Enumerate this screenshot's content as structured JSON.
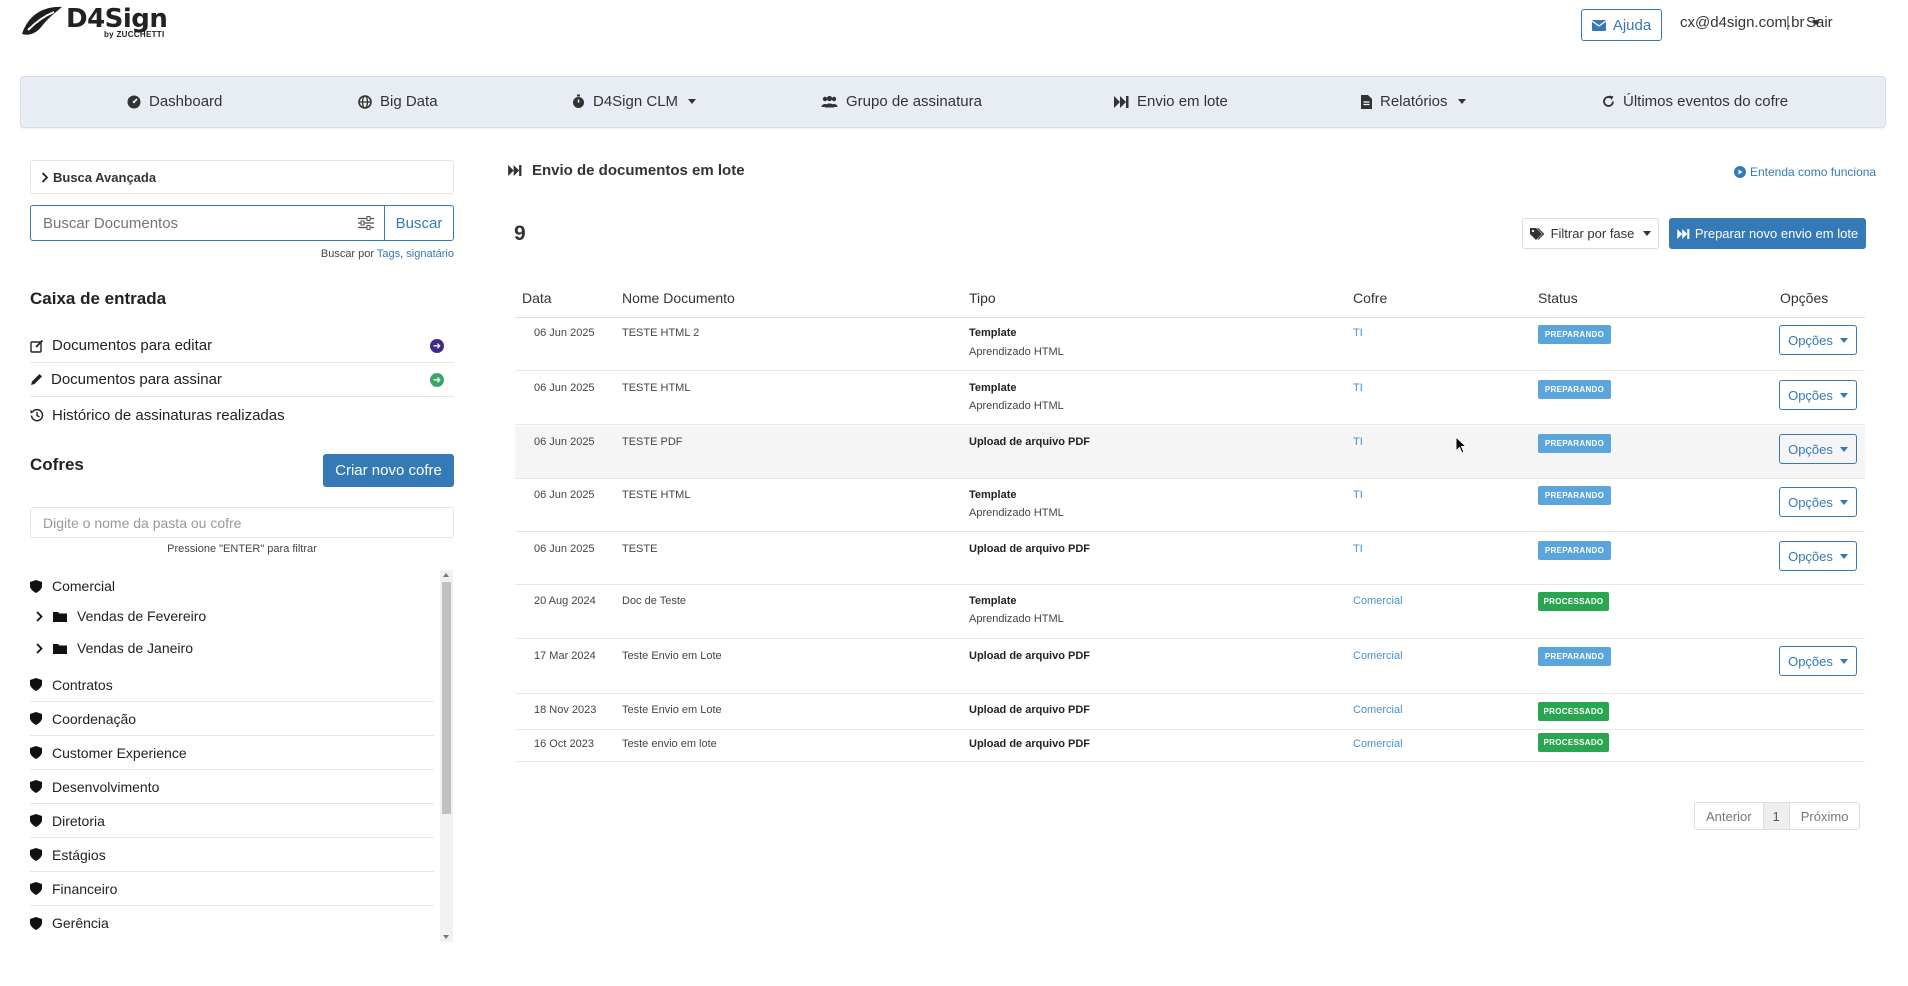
{
  "header": {
    "logo_text": "D4Sign",
    "logo_sub": "by ZUCCHETTI",
    "help_label": "Ajuda",
    "user_email": "cx@d4sign.com.br",
    "separator": "|",
    "logout_label": "Sair"
  },
  "nav": {
    "items": [
      {
        "label": "Dashboard",
        "icon": "dashboard-icon"
      },
      {
        "label": "Big Data",
        "icon": "globe-icon"
      },
      {
        "label": "D4Sign CLM",
        "icon": "stopwatch-icon"
      },
      {
        "label": "Grupo de assinatura",
        "icon": "users-icon"
      },
      {
        "label": "Envio em lote",
        "icon": "fast-forward-icon"
      },
      {
        "label": "Relatórios",
        "icon": "file-icon"
      },
      {
        "label": "Últimos eventos do cofre",
        "icon": "refresh-icon"
      }
    ]
  },
  "sidebar": {
    "advanced_search": "Busca Avançada",
    "search_placeholder": "Buscar Documentos",
    "search_button": "Buscar",
    "search_hint_prefix": "Buscar por",
    "search_hint_tags": "Tags",
    "search_hint_sep": ",",
    "search_hint_signer": "signatário",
    "inbox_title": "Caixa de entrada",
    "inbox_items": [
      {
        "label": "Documentos para editar",
        "icon": "edit-icon"
      },
      {
        "label": "Documentos para assinar",
        "icon": "pencil-icon"
      },
      {
        "label": "Histórico de assinaturas realizadas",
        "icon": "history-icon"
      }
    ],
    "vaults_title": "Cofres",
    "new_vault_button": "Criar novo cofre",
    "folder_filter_placeholder": "Digite o nome da pasta ou cofre",
    "folder_filter_hint": "Pressione \"ENTER\" para filtrar",
    "tree": [
      {
        "label": "Comercial",
        "type": "vault"
      },
      {
        "label": "Vendas de Fevereiro",
        "type": "folder"
      },
      {
        "label": "Vendas de Janeiro",
        "type": "folder"
      },
      {
        "label": "Contratos",
        "type": "vault"
      },
      {
        "label": "Coordenação",
        "type": "vault"
      },
      {
        "label": "Customer Experience",
        "type": "vault"
      },
      {
        "label": "Desenvolvimento",
        "type": "vault"
      },
      {
        "label": "Diretoria",
        "type": "vault"
      },
      {
        "label": "Estágios",
        "type": "vault"
      },
      {
        "label": "Financeiro",
        "type": "vault"
      },
      {
        "label": "Gerência",
        "type": "vault"
      }
    ]
  },
  "main": {
    "title": "Envio de documentos em lote",
    "how_link": "Entenda como funciona",
    "count": "9",
    "filter_button": "Filtrar por fase",
    "prepare_button": "Preparar novo envio em lote",
    "columns": [
      "Data",
      "Nome Documento",
      "Tipo",
      "Cofre",
      "Status",
      "Opções"
    ],
    "rows": [
      {
        "date": "06 Jun 2025",
        "name": "TESTE HTML 2",
        "type": "Template",
        "subtype": "Aprendizado HTML",
        "vault": "TI",
        "status": "PREPARANDO",
        "options": "Opções"
      },
      {
        "date": "06 Jun 2025",
        "name": "TESTE HTML",
        "type": "Template",
        "subtype": "Aprendizado HTML",
        "vault": "TI",
        "status": "PREPARANDO",
        "options": "Opções"
      },
      {
        "date": "06 Jun 2025",
        "name": "TESTE PDF",
        "type": "Upload de arquivo PDF",
        "subtype": "",
        "vault": "TI",
        "status": "PREPARANDO",
        "options": "Opções"
      },
      {
        "date": "06 Jun 2025",
        "name": "TESTE HTML",
        "type": "Template",
        "subtype": "Aprendizado HTML",
        "vault": "TI",
        "status": "PREPARANDO",
        "options": "Opções"
      },
      {
        "date": "06 Jun 2025",
        "name": "TESTE",
        "type": "Upload de arquivo PDF",
        "subtype": "",
        "vault": "TI",
        "status": "PREPARANDO",
        "options": "Opções"
      },
      {
        "date": "20 Aug 2024",
        "name": "Doc de Teste",
        "type": "Template",
        "subtype": "Aprendizado HTML",
        "vault": "Comercial",
        "status": "PROCESSADO",
        "options": ""
      },
      {
        "date": "17 Mar 2024",
        "name": "Teste Envio em Lote",
        "type": "Upload de arquivo PDF",
        "subtype": "",
        "vault": "Comercial",
        "status": "PREPARANDO",
        "options": "Opções"
      },
      {
        "date": "18 Nov 2023",
        "name": "Teste Envio em Lote",
        "type": "Upload de arquivo PDF",
        "subtype": "",
        "vault": "Comercial",
        "status": "PROCESSADO",
        "options": ""
      },
      {
        "date": "16 Oct 2023",
        "name": "Teste envio em lote",
        "type": "Upload de arquivo PDF",
        "subtype": "",
        "vault": "Comercial",
        "status": "PROCESSADO",
        "options": ""
      }
    ],
    "pagination": {
      "prev": "Anterior",
      "page": "1",
      "next": "Próximo"
    }
  },
  "colors": {
    "primary": "#337ab7",
    "nav_bg": "#e7edf2",
    "preparing": "#5aa6dc",
    "processed": "#2aa650",
    "inbox_edit_badge": "#3f2a8c",
    "inbox_sign_badge": "#3aa66a"
  }
}
